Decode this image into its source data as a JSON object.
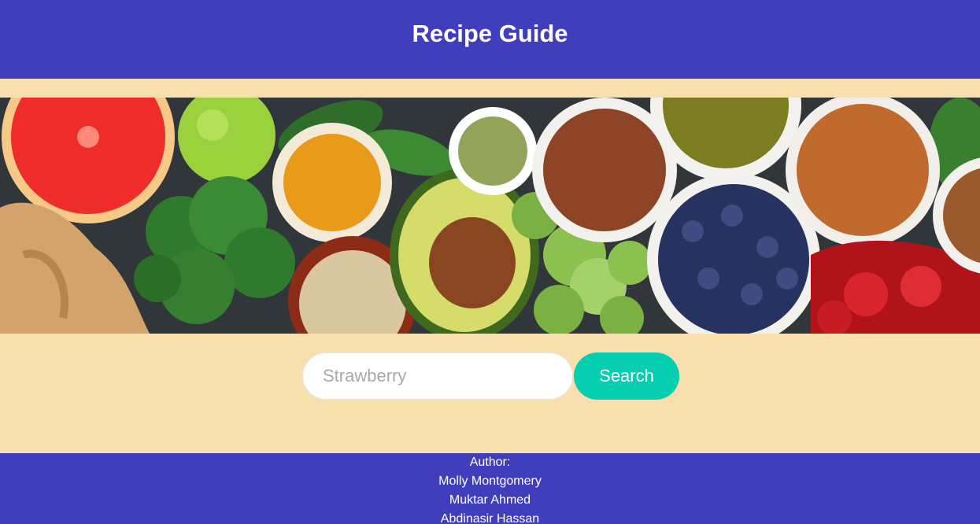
{
  "header": {
    "title": "Recipe Guide"
  },
  "hero": {
    "image_name": "healthy-food-banner"
  },
  "search": {
    "placeholder": "Strawberry",
    "button_label": "Search"
  },
  "footer": {
    "author_label": "Author:",
    "authors": [
      "Molly Montgomery",
      "Muktar Ahmed",
      "Abdinasir Hassan"
    ]
  },
  "colors": {
    "header_bg": "#413ebd",
    "page_bg": "#f8dfae",
    "button_bg": "#06cfb1"
  }
}
